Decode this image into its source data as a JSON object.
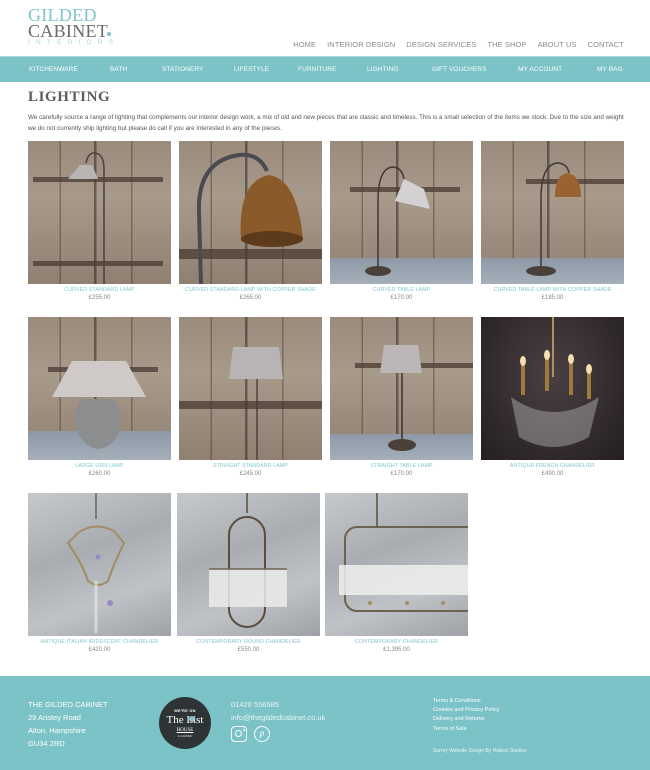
{
  "brand": {
    "line1": "GILDED",
    "line2": "CABINET",
    "line3": "INTERIORS",
    "accent_color": "#7cc3c7"
  },
  "top_nav": [
    "HOME",
    "INTERIOR DESIGN",
    "DESIGN SERVICES",
    "THE SHOP",
    "ABOUT US",
    "CONTACT"
  ],
  "category_nav": [
    "KITCHENWARE",
    "BATH",
    "STATIONERY",
    "LIFESTYLE",
    "FURNITURE",
    "LIGHTING",
    "GIFT VOUCHERS",
    "MY ACCOUNT",
    "MY BAG"
  ],
  "page": {
    "title": "LIGHTING",
    "intro": "We carefully source a range of lighting that complements our interior design work, a mix of old and new pieces that are classic and timeless. This is a small selection of the items we stock. Due to the size and weight we do not currently ship lighting but please do call if you are interested in any of the pieces."
  },
  "products": [
    {
      "name": "CURVED STANDARD LAMP",
      "price": "£255.00",
      "image": "curved-standard-lamp"
    },
    {
      "name": "CURVED STANDARD LAMP WITH COPPER SHADE",
      "price": "£265.00",
      "image": "curved-standard-lamp-copper"
    },
    {
      "name": "CURVED TABLE LAMP",
      "price": "£170.00",
      "image": "curved-table-lamp"
    },
    {
      "name": "CURVED TABLE LAMP WITH COPPER SHADE",
      "price": "£185.00",
      "image": "curved-table-lamp-copper"
    },
    {
      "name": "LARGE URN LAMP",
      "price": "£260.00",
      "image": "large-urn-lamp"
    },
    {
      "name": "STRAIGHT STANDARD LAMP",
      "price": "£245.00",
      "image": "straight-standard-lamp"
    },
    {
      "name": "STRAIGHT TABLE LAMP",
      "price": "£170.00",
      "image": "straight-table-lamp"
    },
    {
      "name": "ANTIQUE FRENCH CHANDELIER",
      "price": "£490.00",
      "image": "antique-french-chandelier"
    },
    {
      "name": "ANTIQUE ITALIAN IRIDESCENT CHANDELIER",
      "price": "£420.00",
      "image": "antique-italian-chandelier"
    },
    {
      "name": "CONTEMPORARY ROUND CHANDELIER",
      "price": "£550.00",
      "image": "contemporary-round-chandelier"
    },
    {
      "name": "CONTEMPORARY CHANDELIER",
      "price": "£1,395.00",
      "image": "contemporary-chandelier"
    }
  ],
  "footer": {
    "address": [
      "THE GILDED CABINET",
      "29 Anstey Road",
      "Alton, Hampshire",
      "GU34 2RD"
    ],
    "badge": {
      "line1": "WE'RE ON",
      "line2": "The List",
      "line3": "HOUSE",
      "line4": "& GARDEN"
    },
    "phone": "01420 556585",
    "email": "info@thegildedcabinet.co.uk",
    "social": [
      "instagram",
      "pinterest"
    ],
    "links": [
      "Terms & Conditions",
      "Cookies and Privacy Policy",
      "Delivery and Returns",
      "Terms of Sale"
    ],
    "credit": "Surrey Website Design By Hatbox Studios"
  }
}
